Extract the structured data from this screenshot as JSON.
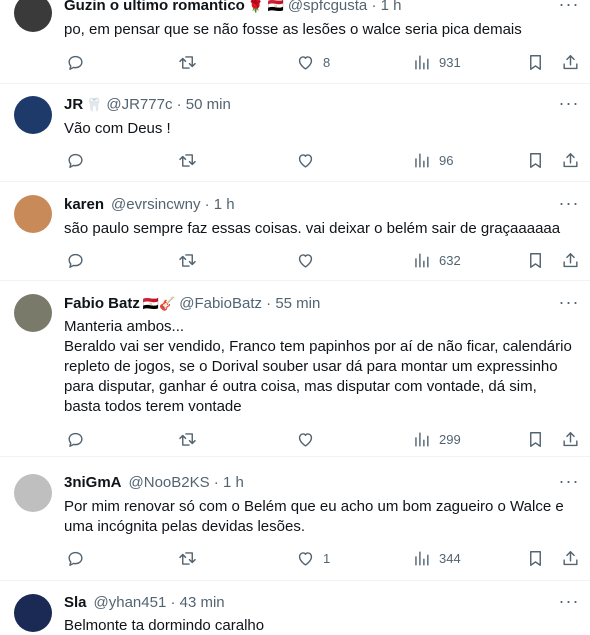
{
  "tweets": [
    {
      "name": "Guzin o ultimo romantico",
      "emoji": "🌹 🇪🇬",
      "handle": "@spfcgusta",
      "time": "· 1 h",
      "text": "po, em pensar que se não fosse as lesões o walce seria pica demais",
      "likes": "8",
      "views": "931",
      "avatar_color": "#3a3a3a"
    },
    {
      "name": "JR",
      "emoji": "🦷",
      "handle": "@JR777c",
      "time": "· 50 min",
      "text": "Vão com Deus !",
      "likes": "",
      "views": "96",
      "avatar_color": "#1d3a6b"
    },
    {
      "name": "karen",
      "emoji": "",
      "handle": "@evrsincwny",
      "time": "· 1 h",
      "text": "são paulo sempre faz essas coisas. vai deixar o belém sair de graçaaaaaa",
      "likes": "",
      "views": "632",
      "avatar_color": "#c98a5a"
    },
    {
      "name": "Fabio Batz",
      "emoji": "🇪🇬🎸",
      "handle": "@FabioBatz",
      "time": "· 55 min",
      "text": "Manteria ambos...\nBeraldo vai ser vendido, Franco tem papinhos por aí de não ficar, calendário repleto de jogos, se o Dorival souber usar dá para montar um expressinho para disputar, ganhar é outra coisa, mas disputar com vontade, dá sim, basta todos terem vontade",
      "likes": "",
      "views": "299",
      "avatar_color": "#7a7a6a"
    },
    {
      "name": "3niGmA",
      "emoji": "",
      "handle": "@NooB2KS",
      "time": "· 1 h",
      "text": "Por mim renovar só com o Belém que eu acho um bom zagueiro o Walce e uma incógnita pelas devidas lesões.",
      "likes": "1",
      "views": "344",
      "avatar_color": "#bfbfbf"
    },
    {
      "name": "Sla",
      "emoji": "",
      "handle": "@yhan451",
      "time": "· 43 min",
      "text": "Belmonte ta dormindo caralho",
      "likes": "",
      "views": "",
      "avatar_color": "#1b2a55"
    }
  ],
  "icons": {
    "reply": "reply-icon",
    "retweet": "retweet-icon",
    "like": "heart-icon",
    "views": "views-icon",
    "bookmark": "bookmark-icon",
    "share": "share-icon",
    "more": "more-icon"
  }
}
